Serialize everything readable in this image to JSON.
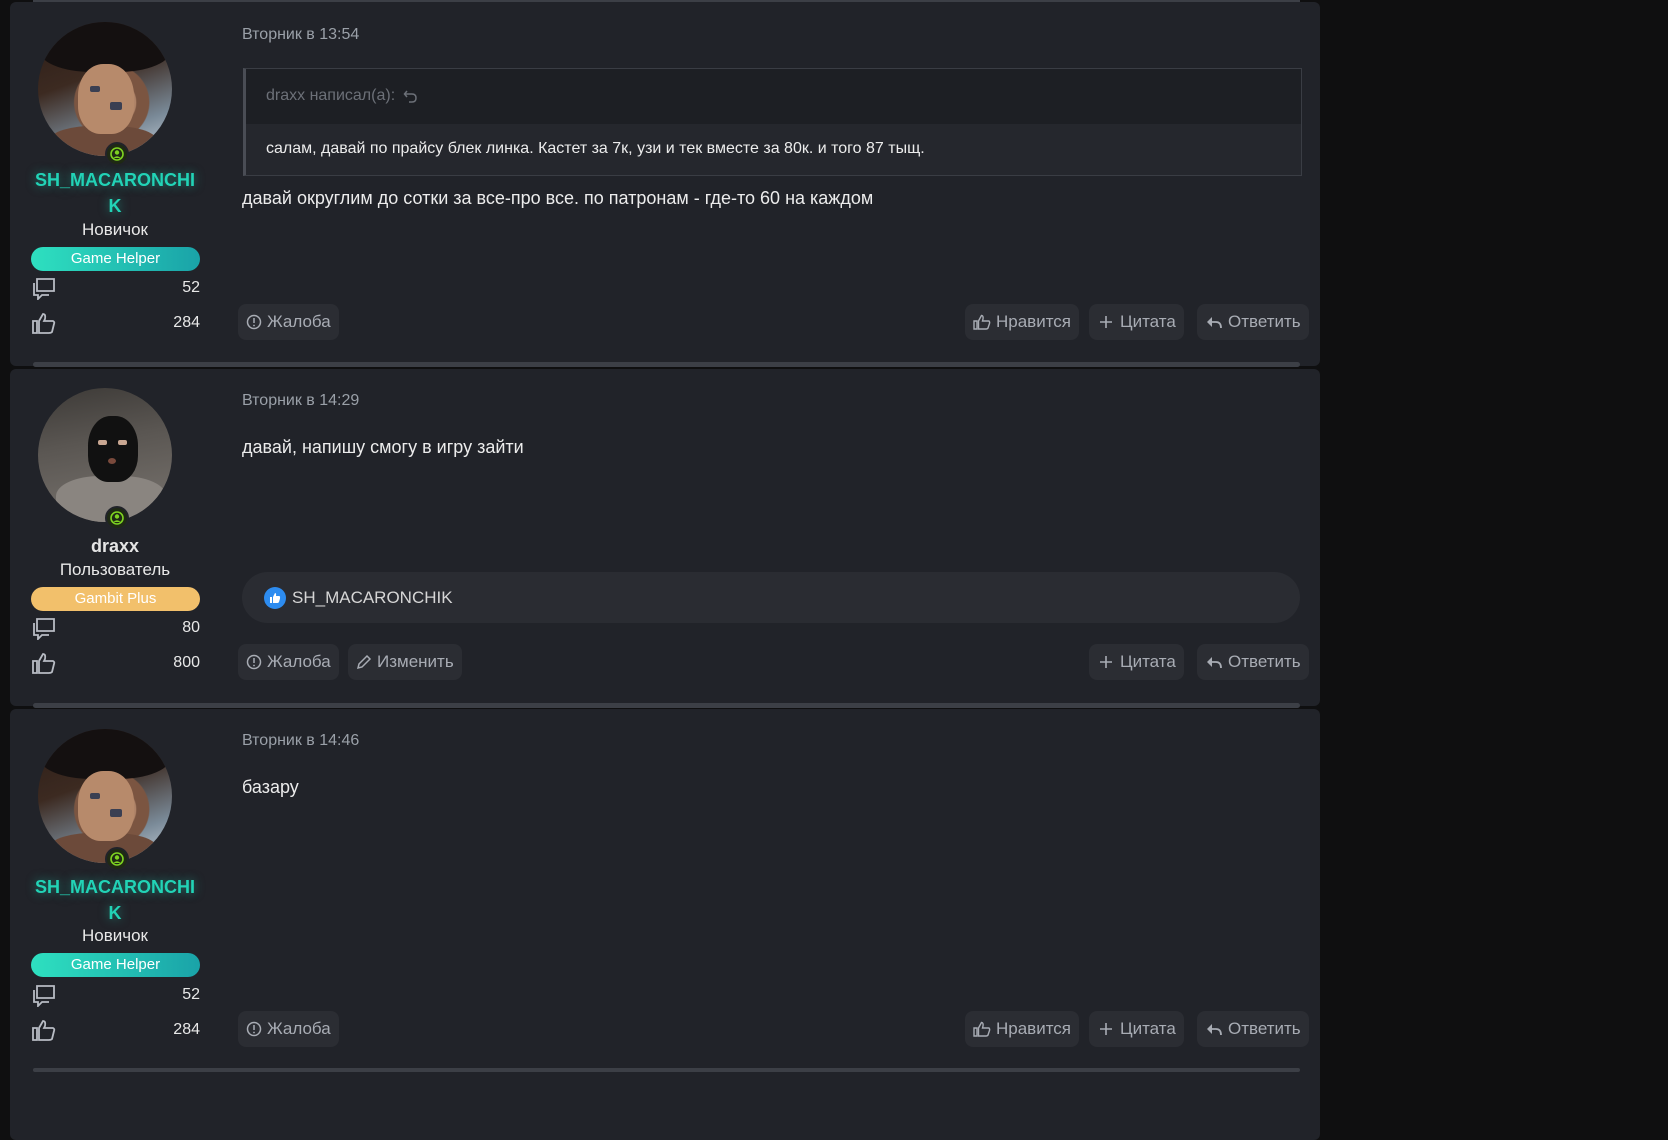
{
  "posts": [
    {
      "user": {
        "name_line1": "SH_MACARONCHI",
        "name_line2": "K",
        "title": "Новичок",
        "badge": "Game Helper",
        "messages": "52",
        "reactions": "284"
      },
      "time": "Вторник в 13:54",
      "quote": {
        "author": "draxx написал(а):",
        "text": "салам, давай по прайсу блек линка. Кастет за 7к, узи и тек вместе за 80к. и того 87 тыщ."
      },
      "message": "давай округлим до сотки за все-про все. по патронам - где-то 60 на каждом",
      "actions": {
        "report": "Жалоба",
        "like": "Нравится",
        "quote": "Цитата",
        "reply": "Ответить"
      }
    },
    {
      "user": {
        "name": "draxx",
        "title": "Пользователь",
        "badge": "Gambit Plus",
        "messages": "80",
        "reactions": "800"
      },
      "time": "Вторник в 14:29",
      "message": "давай, напишу смогу в игру зайти",
      "reaction_user": "SH_MACARONCHIK",
      "actions": {
        "report": "Жалоба",
        "edit": "Изменить",
        "quote": "Цитата",
        "reply": "Ответить"
      }
    },
    {
      "user": {
        "name_line1": "SH_MACARONCHI",
        "name_line2": "K",
        "title": "Новичок",
        "badge": "Game Helper",
        "messages": "52",
        "reactions": "284"
      },
      "time": "Вторник в 14:46",
      "message": "базару",
      "actions": {
        "report": "Жалоба",
        "like": "Нравится",
        "quote": "Цитата",
        "reply": "Ответить"
      }
    }
  ],
  "colors": {
    "accent_teal": "#22d3b6",
    "badge_gold": "#f2c06b",
    "like_blue": "#2d8cf0",
    "background": "#212329"
  },
  "icons": [
    "online-status-icon",
    "comments-icon",
    "thumbs-up-icon",
    "alert-circle-icon",
    "plus-icon",
    "reply-arrow-icon",
    "pencil-icon",
    "undo-arrow-icon"
  ]
}
